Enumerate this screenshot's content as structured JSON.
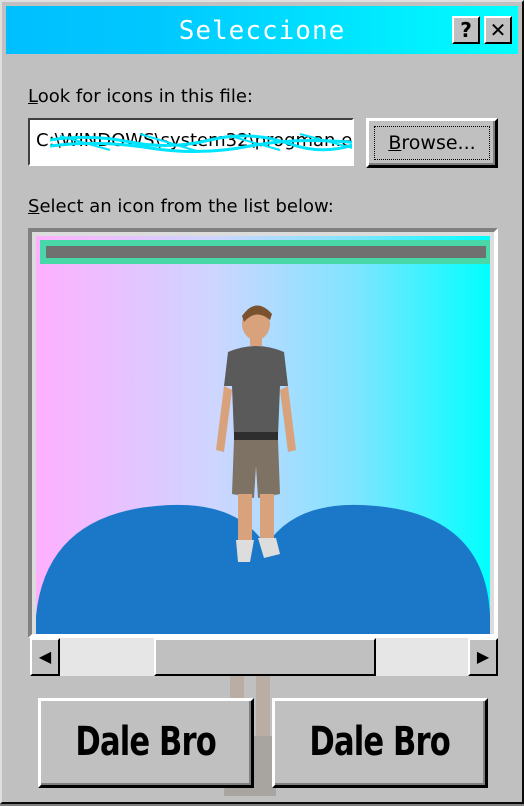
{
  "window": {
    "title": "Seleccione",
    "help_label": "?",
    "close_label": "✕"
  },
  "file_section": {
    "label_prefix": "L",
    "label_rest": "ook for icons in this file:",
    "path_value": "C:\\WINDOWS\\system32\\progman.e",
    "browse_label_u": "B",
    "browse_label_rest": "rowse..."
  },
  "list_section": {
    "label_prefix": "S",
    "label_rest": "elect an icon from the list below:"
  },
  "scroll": {
    "left_arrow": "◀",
    "right_arrow": "▶"
  },
  "buttons": {
    "left_label": "Dale Bro",
    "right_label": "Dale Bro"
  },
  "colors": {
    "titlebar_start": "#00bfff",
    "titlebar_end": "#00ffff",
    "hill": "#1b78c8",
    "scribble": "#00e5ff"
  }
}
